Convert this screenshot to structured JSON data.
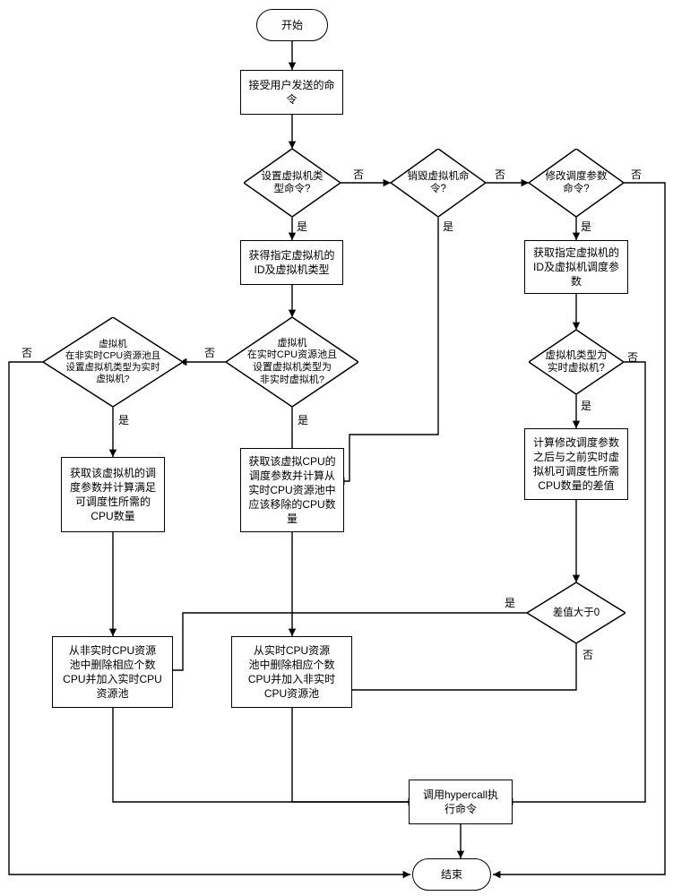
{
  "terminators": {
    "start": "开始",
    "end": "结束"
  },
  "processes": {
    "recv_cmd": "接受用户发送的命\n令",
    "get_vm_id_type": "获得指定虚拟机的\nID及虚拟机类型",
    "get_vm_id_sched": "获取指定虚拟机的\nID及虚拟机调度参\n数",
    "calc_diff": "计算修改调度参数\n之后与之前实时虚\n拟机可调度性所需\nCPU数量的差值",
    "get_sched_needed": "获取该虚拟机的调\n度参数并计算满足\n可调度性所需的\nCPU数量",
    "get_sched_remove": "获取该虚拟CPU的\n调度参数并计算从\n实时CPU资源池中\n应该移除的CPU数\n量",
    "remove_from_nonrt": "从非实时CPU资源\n池中删除相应个数\nCPU并加入实时CPU\n资源池",
    "remove_from_rt": "从实时CPU资源\n池中删除相应个数\nCPU并加入非实时\nCPU资源池",
    "hypercall": "调用hypercall执\n行命令"
  },
  "decisions": {
    "is_set_vm_type": "设置虚拟机类\n型命令?",
    "is_destroy_vm": "销毁虚拟机命\n令?",
    "is_modify_sched": "修改调度参数\n命令?",
    "vm_in_rt_set_nonrt": "虚拟机\n在实时CPU资源池且\n设置虚拟机类型为\n非实时虚拟机?",
    "vm_in_nonrt_set_rt": "虚拟机\n在非实时CPU资源池且\n设置虚拟机类型为实时\n虚拟机?",
    "vm_type_is_rt": "虚拟机类型为\n实时虚拟机?",
    "diff_gt_zero": "差值大于0"
  },
  "labels": {
    "yes": "是",
    "no": "否"
  }
}
